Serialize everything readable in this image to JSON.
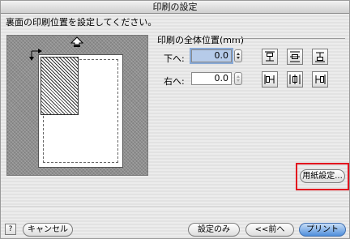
{
  "window": {
    "title": "印刷の設定"
  },
  "instruction": "裏面の印刷位置を設定してください。",
  "position_group": {
    "title": "印刷の全体位置(mm)",
    "down_label": "下へ:",
    "down_value": "0.0",
    "right_label": "右へ:",
    "right_value": "0.0"
  },
  "buttons": {
    "paper_settings": "用紙設定...",
    "help": "?",
    "cancel": "キャンセル",
    "settings_only": "設定のみ",
    "prev": "<<前へ",
    "print": "プリント"
  },
  "icons": {
    "preview_up_arrow": "up-arrow-icon",
    "preview_corner_arrows": "move-arrows-icon",
    "align_top": "align-top-icon",
    "align_vcenter": "align-vertical-center-icon",
    "align_bottom": "align-bottom-icon",
    "align_left": "align-left-icon",
    "align_hcenter": "align-horizontal-center-icon",
    "align_right": "align-right-icon"
  },
  "colors": {
    "highlight": "#e3141f",
    "default_button": "#4f8fdb",
    "active_field": "#b6cbe9"
  }
}
